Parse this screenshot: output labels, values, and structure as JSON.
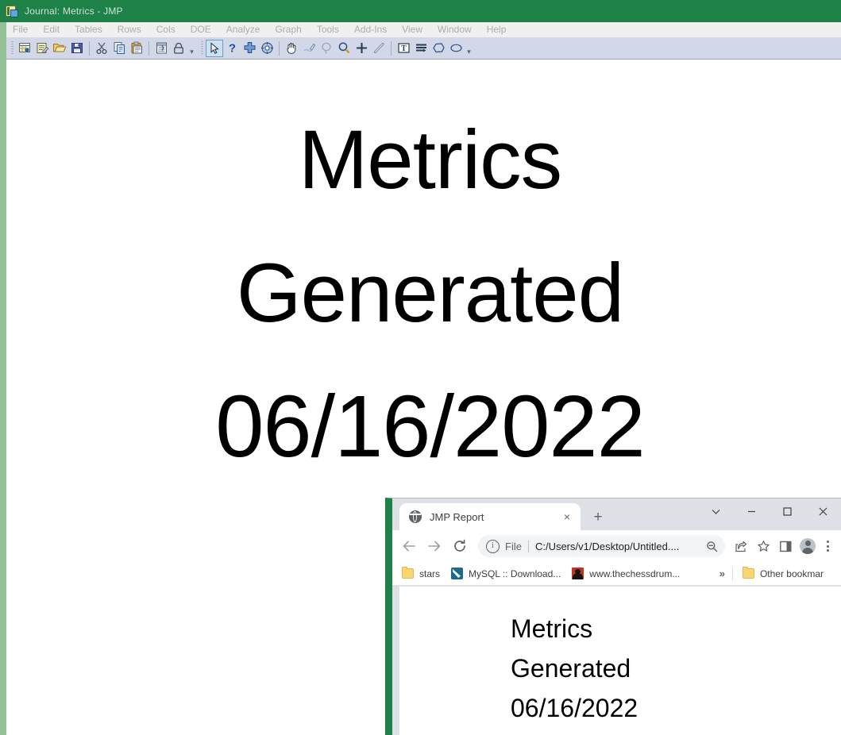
{
  "jmp": {
    "title": "Journal: Metrics - JMP",
    "window_icon": "jmp-app-icon",
    "accent_green": "#1E8147",
    "menu": [
      {
        "label": "File",
        "mnemonic": "F"
      },
      {
        "label": "Edit",
        "mnemonic": "E"
      },
      {
        "label": "Tables",
        "mnemonic": "T"
      },
      {
        "label": "Rows",
        "mnemonic": "R"
      },
      {
        "label": "Cols",
        "mnemonic": "C"
      },
      {
        "label": "DOE",
        "mnemonic": "D"
      },
      {
        "label": "Analyze",
        "mnemonic": "A"
      },
      {
        "label": "Graph",
        "mnemonic": "G"
      },
      {
        "label": "Tools",
        "mnemonic": "o"
      },
      {
        "label": "Add-Ins",
        "mnemonic": "n"
      },
      {
        "label": "View",
        "mnemonic": "V"
      },
      {
        "label": "Window",
        "mnemonic": "W"
      },
      {
        "label": "Help",
        "mnemonic": "H"
      }
    ],
    "toolbar_icons": [
      "new-data-table-icon",
      "new-script-icon",
      "open-file-icon",
      "save-icon",
      "cut-icon",
      "copy-icon",
      "paste-icon",
      "data-filter-icon",
      "lock-icon",
      "arrow-select-tool-icon",
      "help-tool-icon",
      "crosshair-tool-icon",
      "scroller-tool-icon",
      "grabber-hand-tool-icon",
      "brush-tool-icon",
      "lasso-tool-icon",
      "magnifier-tool-icon",
      "crosshairs-annotate-icon",
      "line-tool-icon",
      "text-annotate-icon",
      "simple-shape-icon",
      "polygon-tool-icon",
      "oval-tool-icon"
    ],
    "journal": {
      "lines": [
        "Metrics",
        "Generated",
        "06/16/2022"
      ]
    }
  },
  "browser": {
    "tab": {
      "title": "JMP Report",
      "favicon": "globe-icon",
      "close_label": "×"
    },
    "new_tab_label": "+",
    "window_controls": [
      {
        "name": "tab-search-button",
        "glyph": "chevron-down"
      },
      {
        "name": "minimize-button",
        "glyph": "minimize"
      },
      {
        "name": "maximize-button",
        "glyph": "maximize"
      },
      {
        "name": "close-button",
        "glyph": "close"
      }
    ],
    "nav": {
      "back_label": "←",
      "forward_label": "→",
      "reload_label": "↻"
    },
    "omnibox": {
      "info_glyph": "i",
      "scheme_label": "File",
      "url": "C:/Users/v1/Desktop/Untitled....",
      "zoom_icon": "zoom-out-icon"
    },
    "toolbar_icons": [
      "share-icon",
      "bookmark-star-icon",
      "side-panel-icon",
      "profile-avatar-icon",
      "chrome-menu-icon"
    ],
    "bookmarks": [
      {
        "label": "stars",
        "icon": "folder-icon"
      },
      {
        "label": "MySQL :: Download...",
        "icon": "mysql-icon"
      },
      {
        "label": "www.thechessdrum...",
        "icon": "chessdrum-icon"
      }
    ],
    "bookmarks_overflow_label": "»",
    "other_bookmarks_label": "Other bookmar",
    "other_bookmarks_icon": "folder-icon",
    "page": {
      "lines": [
        "Metrics",
        "Generated",
        "06/16/2022"
      ]
    }
  }
}
